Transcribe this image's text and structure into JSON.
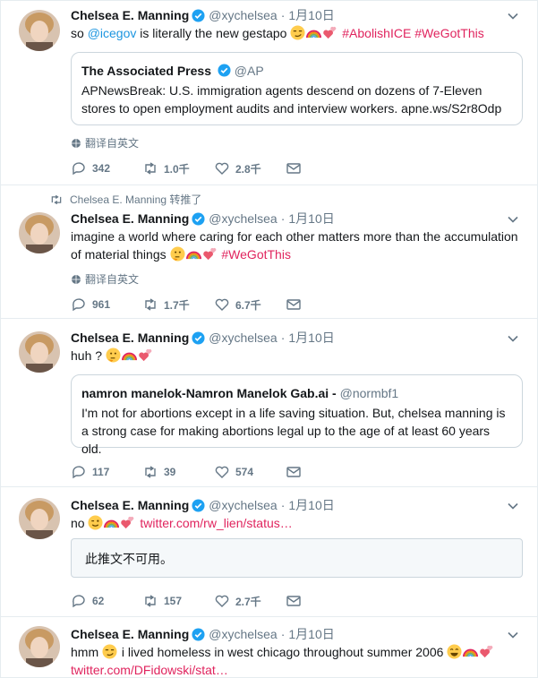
{
  "tweets": [
    {
      "name": "Chelsea E. Manning",
      "handle": "@xychelsea",
      "time": "1月10日",
      "text_parts": {
        "t1": "so ",
        "mention": "@icegov",
        "t2": " is literally the new gestapo ",
        "h1": "#AbolishICE",
        "h2": "#WeGotThis"
      },
      "emoji": [
        "smirk-emoji",
        "rainbow-emoji",
        "two-hearts-emoji"
      ],
      "quote": {
        "name": "The Associated Press",
        "handle": "@AP",
        "text": "APNewsBreak: U.S. immigration agents descend on dozens of 7-Eleven stores to open employment audits and interview workers. apne.ws/S2r8Odp"
      },
      "translate": "翻译自英文",
      "replies": "342",
      "retweets": "1.0千",
      "likes": "2.8千"
    },
    {
      "retweet_context": "Chelsea E. Manning 转推了",
      "name": "Chelsea E. Manning",
      "handle": "@xychelsea",
      "time": "1月10日",
      "text_parts": {
        "t1": "imagine a world where caring for each other matters more than the accumulation of material things ",
        "h1": "#WeGotThis"
      },
      "emoji": [
        "thinking-emoji",
        "rainbow-emoji",
        "two-hearts-emoji"
      ],
      "translate": "翻译自英文",
      "replies": "961",
      "retweets": "1.7千",
      "likes": "6.7千"
    },
    {
      "name": "Chelsea E. Manning",
      "handle": "@xychelsea",
      "time": "1月10日",
      "text_parts": {
        "t1": "huh ? "
      },
      "emoji": [
        "thinking-emoji",
        "rainbow-emoji",
        "two-hearts-emoji"
      ],
      "quote": {
        "name": "namron manelok-Namron Manelok Gab.ai -",
        "handle": "@normbf1",
        "text": "I'm not for abortions except in a life saving situation. But, chelsea manning is a strong case for making abortions legal up to the age of at least 60 years old."
      },
      "replies": "117",
      "retweets": "39",
      "likes": "574"
    },
    {
      "name": "Chelsea E. Manning",
      "handle": "@xychelsea",
      "time": "1月10日",
      "text_parts": {
        "t1": "no ",
        "link": "twitter.com/rw_lien/status…"
      },
      "emoji": [
        "winking-emoji",
        "rainbow-emoji",
        "two-hearts-emoji"
      ],
      "unavailable": "此推文不可用。",
      "replies": "62",
      "retweets": "157",
      "likes": "2.7千"
    },
    {
      "name": "Chelsea E. Manning",
      "handle": "@xychelsea",
      "time": "1月10日",
      "text_parts": {
        "t1": "hmm ",
        "t2": " i lived homeless in west chicago throughout summer 2006 ",
        "link": "twitter.com/DFidowski/stat…"
      },
      "emoji": [
        "smirk-emoji",
        "grinning-emoji",
        "rainbow-emoji",
        "two-hearts-emoji"
      ]
    }
  ],
  "colors": {
    "link": "#1b95e0",
    "hashtag": "#e0245e",
    "verified": "#1da1f2",
    "muted": "#657786"
  }
}
